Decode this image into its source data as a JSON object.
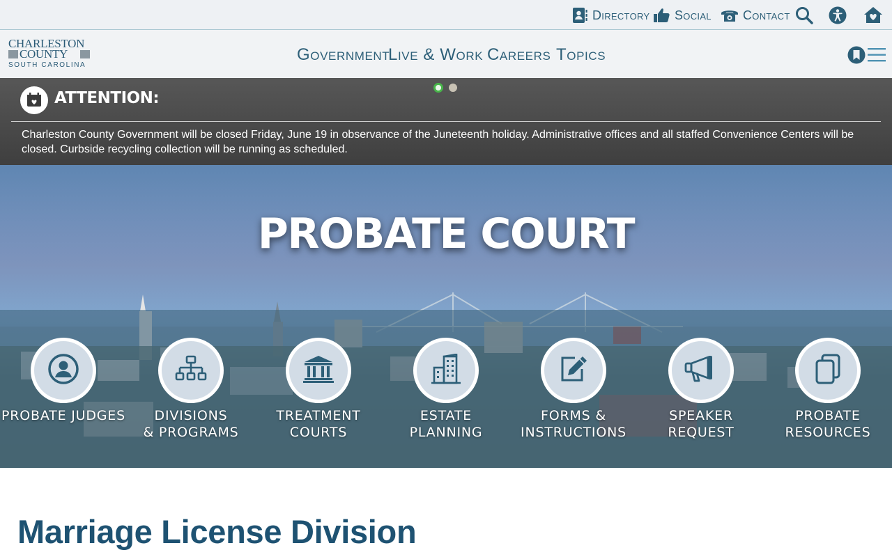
{
  "utility": {
    "directory": "Directory",
    "social": "Social",
    "contact": "Contact"
  },
  "logo": {
    "line1": "CHARLESTON",
    "line2": "COUNTY",
    "line3": "SOUTH CAROLINA"
  },
  "nav": {
    "government": "Government",
    "live_work": "Live & Work",
    "careers": "Careers",
    "topics": "Topics"
  },
  "alert": {
    "title": "ATTENTION:",
    "message": "Charleston County Government will be closed Friday, June 19 in observance of the Juneteenth holiday. Administrative offices and all staffed Convenience Centers will be closed. Curbside recycling collection will be running as scheduled."
  },
  "hero": {
    "title": "PROBATE COURT",
    "tiles": [
      {
        "line1": "Probate Judges",
        "line2": ""
      },
      {
        "line1": "Divisions",
        "line2": "& Programs"
      },
      {
        "line1": "Treatment",
        "line2": "Courts"
      },
      {
        "line1": "Estate Planning",
        "line2": ""
      },
      {
        "line1": "Forms &",
        "line2": "Instructions"
      },
      {
        "line1": "Speaker Request",
        "line2": ""
      },
      {
        "line1": "Probate",
        "line2": "Resources"
      }
    ]
  },
  "main": {
    "title": "Marriage License Division"
  },
  "colors": {
    "brand": "#2d5f78",
    "alert_bg": "#4a4a4a",
    "active_dot": "#48b54a",
    "inactive_dot": "#c8c2b4",
    "tile_fill": "#d2dce6",
    "title": "#1e5272"
  },
  "icons": {
    "directory": "address-book-icon",
    "social": "thumbs-up-icon",
    "contact": "phone-icon",
    "search": "search-icon",
    "accessibility": "accessibility-icon",
    "home": "home-heart-icon",
    "bookmark": "bookmark-icon",
    "menu": "hamburger-menu-icon",
    "alert": "calendar-alert-icon"
  }
}
